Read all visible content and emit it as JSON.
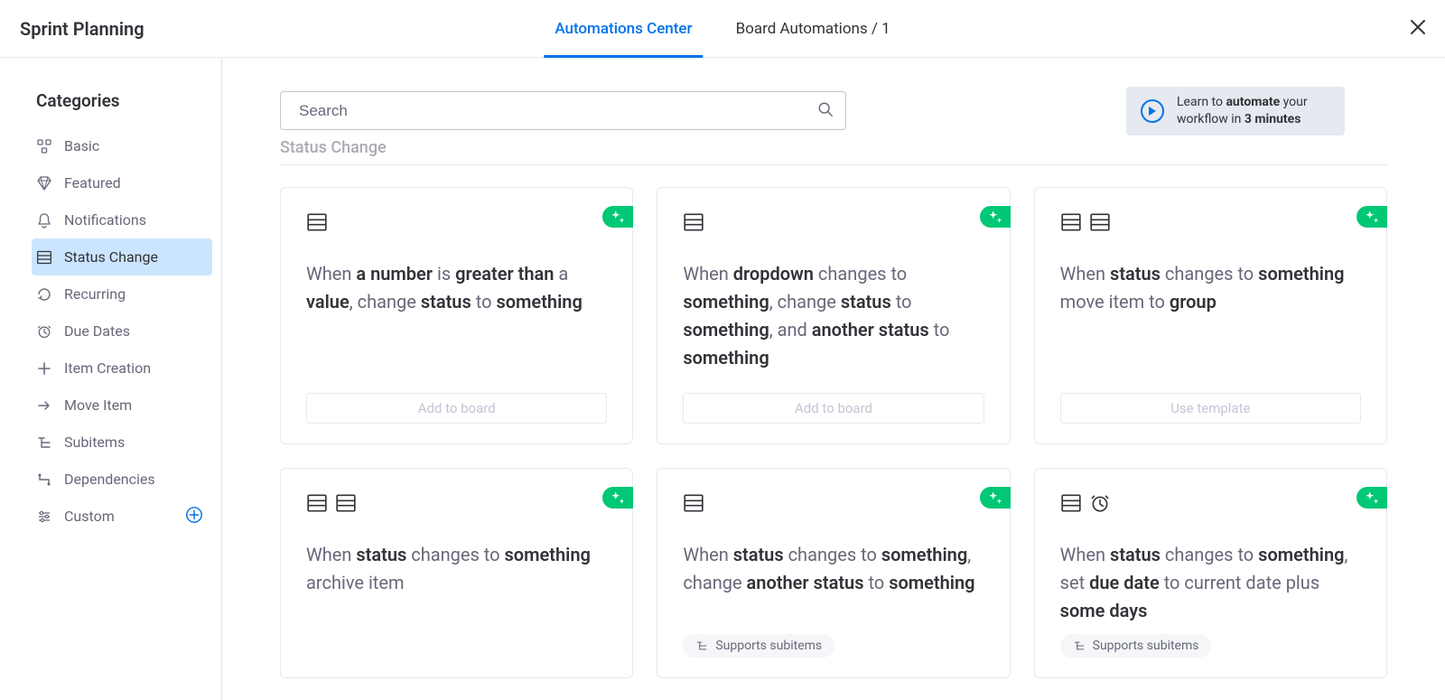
{
  "header": {
    "title": "Sprint Planning",
    "tabs": [
      {
        "label": "Automations Center",
        "active": true
      },
      {
        "label": "Board Automations / 1",
        "active": false
      }
    ]
  },
  "sidebar": {
    "title": "Categories",
    "items": [
      {
        "label": "Basic",
        "icon": "grid-icon"
      },
      {
        "label": "Featured",
        "icon": "diamond-icon"
      },
      {
        "label": "Notifications",
        "icon": "bell-icon"
      },
      {
        "label": "Status Change",
        "icon": "list-icon",
        "active": true
      },
      {
        "label": "Recurring",
        "icon": "recurring-icon"
      },
      {
        "label": "Due Dates",
        "icon": "clock-icon"
      },
      {
        "label": "Item Creation",
        "icon": "plus-icon"
      },
      {
        "label": "Move Item",
        "icon": "arrow-right-icon"
      },
      {
        "label": "Subitems",
        "icon": "subitems-icon"
      },
      {
        "label": "Dependencies",
        "icon": "dependencies-icon"
      },
      {
        "label": "Custom",
        "icon": "sliders-icon",
        "trailing_plus": true
      }
    ]
  },
  "search": {
    "placeholder": "Search"
  },
  "learn": {
    "line1_prefix": "Learn to ",
    "line1_bold": "automate",
    "line1_suffix": " your",
    "line2_prefix": "workflow in ",
    "line2_bold": "3 minutes"
  },
  "section": {
    "title": "Status Change"
  },
  "cards": [
    {
      "icons": [
        "list"
      ],
      "recipe_html": "When <b>a number</b> is <b>greater than</b> a <b>value</b>, change <b>status</b> to <b>something</b>",
      "button": "Add to board"
    },
    {
      "icons": [
        "list"
      ],
      "recipe_html": "When <b>dropdown</b> changes to <b>something</b>, change <b>status</b> to <b>something</b>, and <b>another status</b> to <b>something</b>",
      "button": "Add to board"
    },
    {
      "icons": [
        "list",
        "list"
      ],
      "recipe_html": "When <b>status</b> changes to <b>something</b> move item to <b>group</b>",
      "button": "Use template"
    },
    {
      "icons": [
        "list",
        "list"
      ],
      "recipe_html": "When <b>status</b> changes to <b>something</b> archive item"
    },
    {
      "icons": [
        "list"
      ],
      "recipe_html": "When <b>status</b> changes to <b>something</b>, change <b>another status</b> to <b>something</b>",
      "pill": "Supports subitems"
    },
    {
      "icons": [
        "list",
        "clock"
      ],
      "recipe_html": "When <b>status</b> changes to <b>something</b>, set <b>due date</b> to current date plus <b>some days</b>",
      "pill": "Supports subitems"
    }
  ]
}
